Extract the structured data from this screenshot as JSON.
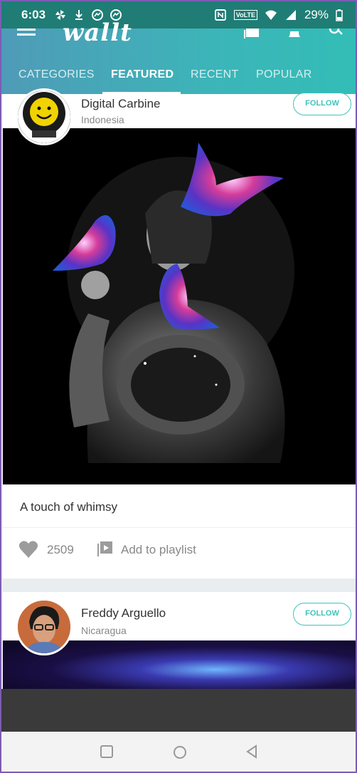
{
  "status_bar": {
    "time": "6:03",
    "network_label": "VoLTE",
    "battery": "29%"
  },
  "app": {
    "logo": "wallt"
  },
  "tabs": [
    {
      "label": "CATEGORIES",
      "active": false
    },
    {
      "label": "FEATURED",
      "active": true
    },
    {
      "label": "RECENT",
      "active": false
    },
    {
      "label": "POPULAR",
      "active": false
    }
  ],
  "posts": [
    {
      "author": "Digital Carbine",
      "location": "Indonesia",
      "follow_label": "FOLLOW",
      "caption": "A touch of whimsy",
      "likes": "2509",
      "playlist_label": "Add to playlist"
    },
    {
      "author": "Freddy Arguello",
      "location": "Nicaragua",
      "follow_label": "FOLLOW"
    }
  ],
  "colors": {
    "status_bar": "#1f7d75",
    "header_start": "#4f9bb7",
    "header_end": "#33bdb7",
    "accent": "#3fc3bb"
  }
}
